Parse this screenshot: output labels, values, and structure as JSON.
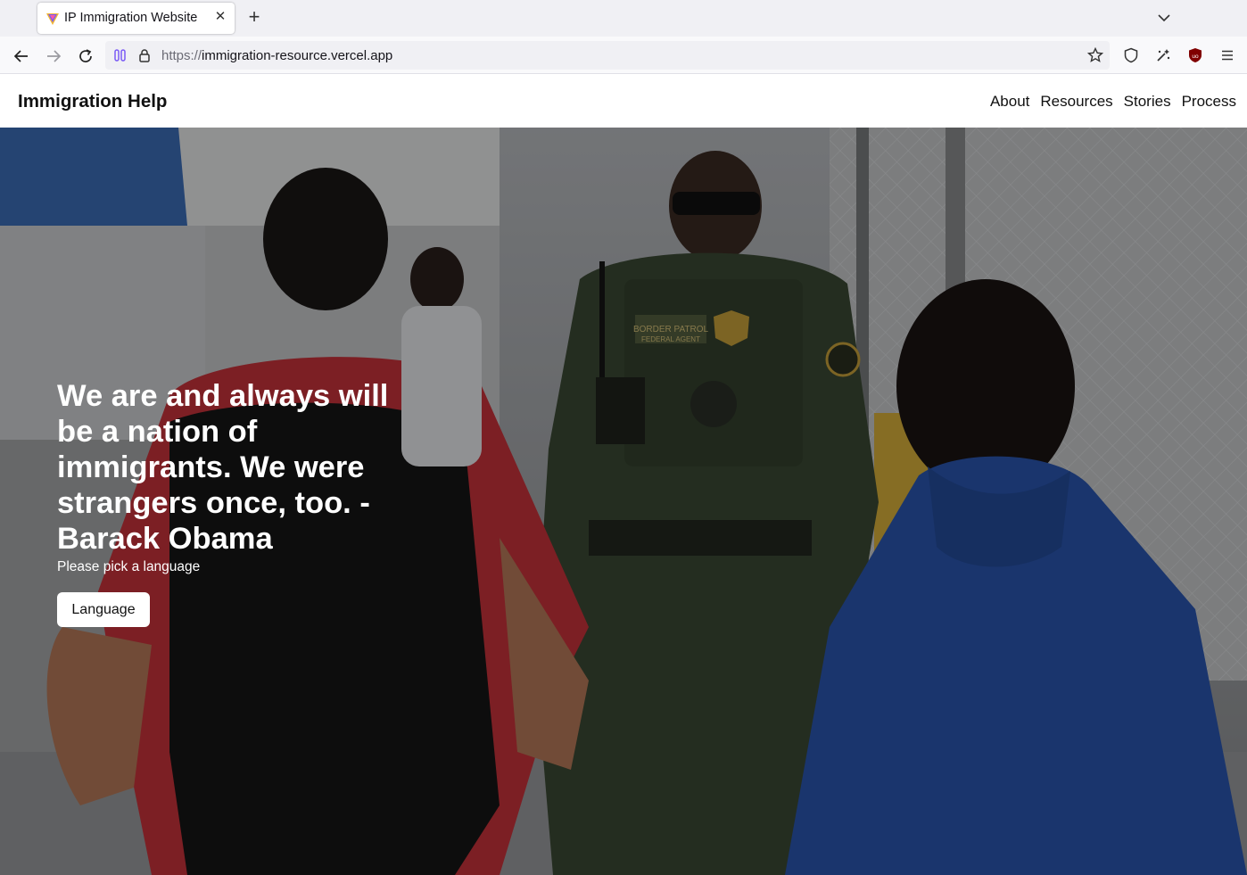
{
  "browser": {
    "tab_title": "IP Immigration Website",
    "url_scheme": "https://",
    "url_host": "immigration-resource.vercel.app"
  },
  "site": {
    "logo": "Immigration Help",
    "nav": [
      "About",
      "Resources",
      "Stories",
      "Process"
    ]
  },
  "hero": {
    "quote": "We are and always will be a nation of immigrants. We were strangers once, too. - Barack Obama",
    "subtitle": "Please pick a language",
    "button_label": "Language",
    "photo_patch_left": "BORDER PATROL",
    "photo_patch_left_sub": "FEDERAL AGENT"
  },
  "colors": {
    "uniform": "#3b4a34",
    "red_shirt": "#c8333b",
    "blue_hoodie": "#2a56b0"
  }
}
